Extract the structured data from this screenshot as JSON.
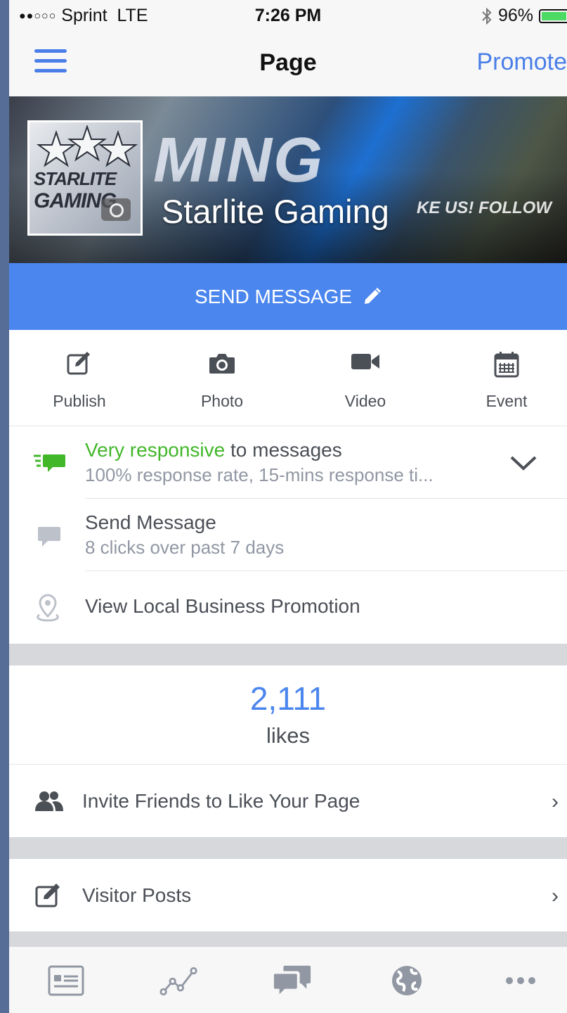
{
  "status_bar": {
    "carrier": "Sprint",
    "network": "LTE",
    "time": "7:26 PM",
    "battery": "96%",
    "battery_level": 0.96,
    "signal_strength": 2,
    "signal_max": 5
  },
  "nav": {
    "title": "Page",
    "right_action": "Promote"
  },
  "cover": {
    "page_name": "Starlite Gaming",
    "art_text": "MING",
    "art_side_text": "KE US!  FOLLOW",
    "logo_text_line1": "STARLITE",
    "logo_text_line2": "GAMING"
  },
  "send_message_button": "SEND MESSAGE",
  "actions": [
    {
      "label": "Publish",
      "icon": "compose-icon"
    },
    {
      "label": "Photo",
      "icon": "camera-icon"
    },
    {
      "label": "Video",
      "icon": "video-icon"
    },
    {
      "label": "Event",
      "icon": "calendar-icon"
    }
  ],
  "responsiveness": {
    "highlight": "Very responsive",
    "rest": " to messages",
    "detail": "100% response rate, 15-mins response ti..."
  },
  "send_message_row": {
    "title": "Send Message",
    "detail": "8 clicks over past 7 days"
  },
  "local_business": {
    "title": "View Local Business Promotion"
  },
  "likes": {
    "count": "2,111",
    "label": "likes"
  },
  "invite_friends": {
    "title": "Invite Friends to Like Your Page"
  },
  "visitor_posts": {
    "title": "Visitor Posts"
  },
  "tab_bar": [
    "news-feed-icon",
    "insights-icon",
    "messages-icon",
    "globe-icon",
    "more-icon"
  ],
  "colors": {
    "accent": "#4b86ee",
    "responsive_green": "#42b72a",
    "text": "#4b4f56",
    "subtext": "#9197a3"
  }
}
